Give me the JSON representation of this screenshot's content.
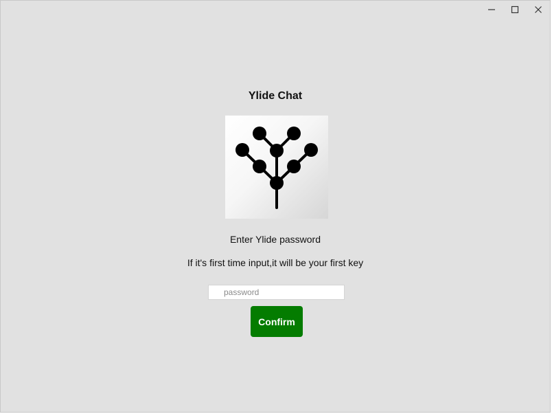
{
  "window": {
    "controls": {
      "minimize_icon": "minimize-icon",
      "maximize_icon": "maximize-icon",
      "close_icon": "close-icon"
    }
  },
  "app": {
    "title": "Ylide Chat",
    "logo_icon": "ylide-tree-logo",
    "prompt": "Enter Ylide password",
    "hint": "If it's first time input,it will be your first key"
  },
  "form": {
    "password": {
      "placeholder": "password",
      "value": ""
    },
    "confirm_label": "Confirm"
  },
  "colors": {
    "window_bg": "#e1e1e1",
    "confirm_bg": "#047c00",
    "confirm_text": "#ffffff",
    "logo_fg": "#000000"
  }
}
